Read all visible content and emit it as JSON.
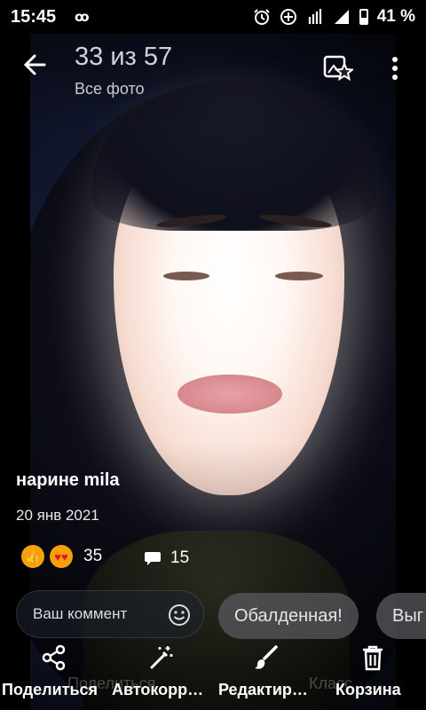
{
  "status_bar": {
    "time": "15:45",
    "indicator": "ꝏ",
    "battery_percent": "41 %"
  },
  "toolbar": {
    "counter": "33 из 57",
    "album": "Все фото"
  },
  "post": {
    "author": "нарине mila",
    "date": "20 янв 2021",
    "likes": "35",
    "comments": "15"
  },
  "comment_bar": {
    "placeholder": "Ваш коммент",
    "quick_replies": [
      "Обалденная!",
      "Выг"
    ]
  },
  "actions": {
    "share": "Поделиться",
    "autocorrect": "Автокорр…",
    "edit": "Редактир…",
    "trash": "Корзина"
  },
  "ghost_labels": {
    "share": "Поделиться",
    "class": "Класс"
  },
  "colors": {
    "reaction_orange": "#f7a10a",
    "chip_bg": "#5a5a5f"
  }
}
